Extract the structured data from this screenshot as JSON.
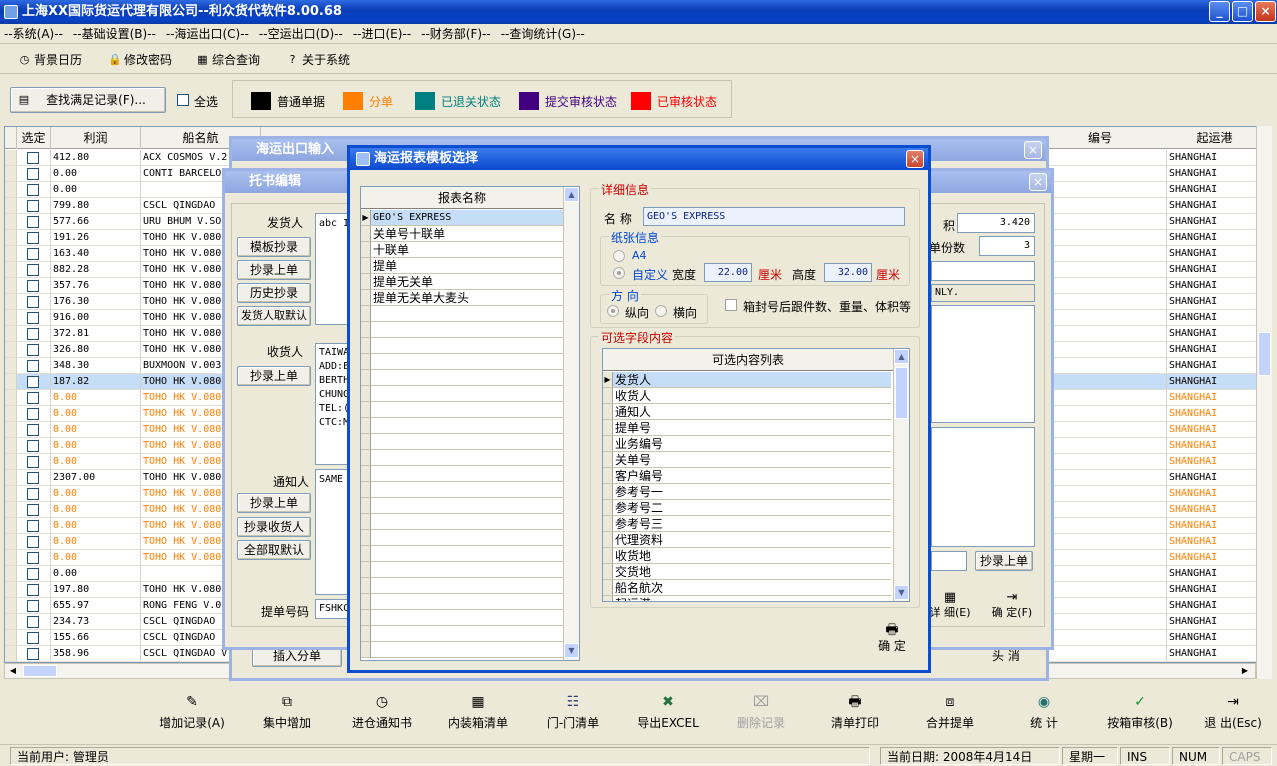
{
  "window": {
    "title": "上海XX国际货运代理有限公司--利众货代软件8.00.68",
    "min": "_",
    "max": "□",
    "close": "×"
  },
  "menu": [
    "--系统(A)--",
    "--基础设置(B)--",
    "--海运出口(C)--",
    "--空运出口(D)--",
    "--进口(E)--",
    "--财务部(F)--",
    "--查询统计(G)--"
  ],
  "toolbar": [
    {
      "label": "背景日历",
      "icon": "clock-icon"
    },
    {
      "label": "修改密码",
      "icon": "lock-icon"
    },
    {
      "label": "综合查询",
      "icon": "grid-icon"
    },
    {
      "label": "关于系统",
      "icon": "question-icon"
    }
  ],
  "search": {
    "find_label": "查找满足记录(F)...",
    "select_all": "全选"
  },
  "legend": [
    {
      "label": "普通单据",
      "color": "#000000"
    },
    {
      "label": "分单",
      "color": "#FF8000"
    },
    {
      "label": "已退关状态",
      "color": "#008080"
    },
    {
      "label": "提交审核状态",
      "color": "#400080"
    },
    {
      "label": "已审核状态",
      "color": "#FF0000"
    }
  ],
  "grid": {
    "headers": {
      "select": "选定",
      "profit": "利润",
      "vessel": "船名航",
      "bizno": "编号",
      "port": "起运港"
    },
    "rows": [
      {
        "profit": "412.80",
        "vessel": "ACX COSMOS V.2",
        "port": "SHANGHAI",
        "color": "black"
      },
      {
        "profit": "0.00",
        "vessel": "CONTI BARCELO",
        "port": "SHANGHAI",
        "color": "black"
      },
      {
        "profit": "0.00",
        "vessel": "",
        "port": "SHANGHAI",
        "color": "black"
      },
      {
        "profit": "799.80",
        "vessel": "CSCL QINGDAO",
        "port": "SHANGHAI",
        "color": "black"
      },
      {
        "profit": "577.66",
        "vessel": "URU BHUM V.SO",
        "port": "SHANGHAI",
        "color": "black"
      },
      {
        "profit": "191.26",
        "vessel": "TOHO HK V.080",
        "port": "SHANGHAI",
        "color": "black"
      },
      {
        "profit": "163.40",
        "vessel": "TOHO HK V.080",
        "port": "SHANGHAI",
        "color": "black"
      },
      {
        "profit": "882.28",
        "vessel": "TOHO HK V.080",
        "port": "SHANGHAI",
        "color": "black"
      },
      {
        "profit": "357.76",
        "vessel": "TOHO HK V.080",
        "port": "SHANGHAI",
        "color": "black"
      },
      {
        "profit": "176.30",
        "vessel": "TOHO HK V.080",
        "port": "SHANGHAI",
        "color": "black"
      },
      {
        "profit": "916.00",
        "vessel": "TOHO HK V.080",
        "port": "SHANGHAI",
        "color": "black"
      },
      {
        "profit": "372.81",
        "vessel": "TOHO HK V.080",
        "port": "SHANGHAI",
        "color": "black"
      },
      {
        "profit": "326.80",
        "vessel": "TOHO HK V.080",
        "port": "SHANGHAI",
        "color": "black"
      },
      {
        "profit": "348.30",
        "vessel": "BUXMOON V.003",
        "port": "SHANGHAI",
        "color": "black"
      },
      {
        "profit": "187.82",
        "vessel": "TOHO HK V.080",
        "port": "SHANGHAI",
        "color": "black",
        "selected": true
      },
      {
        "profit": "0.00",
        "vessel": "TOHO HK V.080",
        "port": "SHANGHAI",
        "color": "orange"
      },
      {
        "profit": "0.00",
        "vessel": "TOHO HK V.080",
        "port": "SHANGHAI",
        "color": "orange"
      },
      {
        "profit": "0.00",
        "vessel": "TOHO HK V.080",
        "port": "SHANGHAI",
        "color": "orange"
      },
      {
        "profit": "0.00",
        "vessel": "TOHO HK V.080",
        "port": "SHANGHAI",
        "color": "orange"
      },
      {
        "profit": "0.00",
        "vessel": "TOHO HK V.080",
        "port": "SHANGHAI",
        "color": "orange"
      },
      {
        "profit": "2307.00",
        "vessel": "TOHO HK V.080",
        "port": "SHANGHAI",
        "color": "black"
      },
      {
        "profit": "0.00",
        "vessel": "TOHO HK V.080",
        "port": "SHANGHAI",
        "color": "orange"
      },
      {
        "profit": "0.00",
        "vessel": "TOHO HK V.080",
        "port": "SHANGHAI",
        "color": "orange"
      },
      {
        "profit": "0.00",
        "vessel": "TOHO HK V.080",
        "port": "SHANGHAI",
        "color": "orange"
      },
      {
        "profit": "0.00",
        "vessel": "TOHO HK V.080",
        "port": "SHANGHAI",
        "color": "orange"
      },
      {
        "profit": "0.00",
        "vessel": "TOHO HK V.080",
        "port": "SHANGHAI",
        "color": "orange"
      },
      {
        "profit": "0.00",
        "vessel": "",
        "port": "SHANGHAI",
        "color": "black"
      },
      {
        "profit": "197.80",
        "vessel": "TOHO HK V.080",
        "port": "SHANGHAI",
        "color": "black"
      },
      {
        "profit": "655.97",
        "vessel": "RONG FENG V.0",
        "port": "SHANGHAI",
        "color": "black"
      },
      {
        "profit": "234.73",
        "vessel": "CSCL QINGDAO",
        "port": "SHANGHAI",
        "color": "black"
      },
      {
        "profit": "155.66",
        "vessel": "CSCL QINGDAO",
        "port": "SHANGHAI",
        "color": "black"
      },
      {
        "profit": "358.96",
        "vessel": "CSCL QINGDAO V",
        "port": "SHANGHAI",
        "color": "black"
      }
    ]
  },
  "bottom": [
    {
      "label": "增加记录(A)",
      "icon": "add-record-icon"
    },
    {
      "label": "集中增加",
      "icon": "batch-add-icon"
    },
    {
      "label": "进仓通知书",
      "icon": "notice-icon"
    },
    {
      "label": "内装箱清单",
      "icon": "container-list-icon"
    },
    {
      "label": "门-门清单",
      "icon": "door-list-icon"
    },
    {
      "label": "导出EXCEL",
      "icon": "excel-icon"
    },
    {
      "label": "删除记录",
      "icon": "delete-icon",
      "disabled": true
    },
    {
      "label": "清单打印",
      "icon": "print-icon"
    },
    {
      "label": "合并提单",
      "icon": "merge-icon"
    },
    {
      "label": "统 计",
      "icon": "stats-icon"
    },
    {
      "label": "按箱审核(B)",
      "icon": "check-icon"
    },
    {
      "label": "退 出(Esc)",
      "icon": "exit-icon"
    }
  ],
  "status": {
    "user": "当前用户: 管理员",
    "date": "当前日期: 2008年4月14日",
    "weekday": "星期一",
    "ins": "INS",
    "num": "NUM",
    "caps": "CAPS"
  },
  "sea_export": {
    "title": "海运出口输入",
    "insert_label": "插入分单",
    "confirm_short": "头 消"
  },
  "booking": {
    "title": "托书编辑",
    "shipper_label": "发货人",
    "shipper_value": "abc I",
    "consignee_label": "收货人",
    "consignee_lines": [
      "TAIWA",
      "ADD:E",
      "BERTH",
      "CHUNG",
      "TEL:(",
      "CTC:M"
    ],
    "notify_label": "通知人",
    "notify_value": "SAME",
    "bl_label": "提单号码",
    "bl_value": "FSHKC",
    "buttons": [
      "模板抄录",
      "抄录上单",
      "历史抄录",
      "发货人取默认"
    ],
    "consignee_btn": "抄录上单",
    "notify_btns": [
      "抄录上单",
      "抄录收货人",
      "全部取默认"
    ],
    "volume_label": "积",
    "volume_value": "3.420",
    "copies_label": "单份数",
    "copies_value": "3",
    "only_text": "NLY.",
    "copy_btn": "抄录上单",
    "detail_label": "详 细(E)",
    "confirm_label": "确 定(F)"
  },
  "template": {
    "title": "海运报表模板选择",
    "list_header": "报表名称",
    "items": [
      "GEO'S EXPRESS",
      "关单号十联单",
      "十联单",
      "提单",
      "提单无关单",
      "提单无关单大麦头"
    ],
    "detail_title": "详细信息",
    "name_label": "名 称",
    "name_value": "GEO'S EXPRESS",
    "paper_title": "纸张信息",
    "a4": "A4",
    "custom": "自定义",
    "width_label": "宽度",
    "width_value": "22.00",
    "height_label": "高度",
    "height_value": "32.00",
    "unit": "厘米",
    "direction_title": "方 向",
    "portrait": "纵向",
    "landscape": "横向",
    "checkbox_label": "箱封号后跟件数、重量、体积等",
    "fields_title": "可选字段内容",
    "fields_header": "可选内容列表",
    "fields": [
      "发货人",
      "收货人",
      "通知人",
      "提单号",
      "业务编号",
      "关单号",
      "客户编号",
      "参考号一",
      "参考号二",
      "参考号三",
      "代理资料",
      "收货地",
      "交货地",
      "船名航次",
      "起运港"
    ],
    "ok": "确 定"
  }
}
